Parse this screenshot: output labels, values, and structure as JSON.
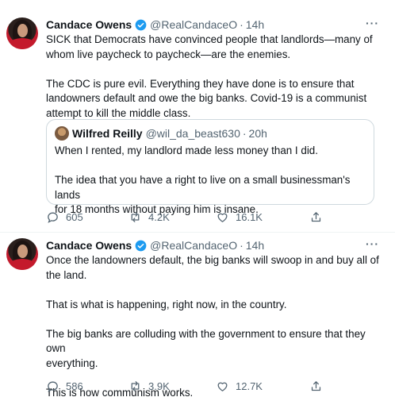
{
  "tweets": [
    {
      "author": {
        "name": "Candace Owens",
        "handle": "@RealCandaceO",
        "time": "14h"
      },
      "paragraphs": [
        [
          "SICK that Democrats have convinced people that landlords—many of",
          "whom live paycheck to paycheck—are the enemies."
        ],
        [
          "The CDC is pure evil. Everything they have done is to ensure that",
          "landowners default and owe the big banks. Covid-19 is a communist",
          "attempt to kill the middle class."
        ]
      ],
      "quote": {
        "author": {
          "name": "Wilfred Reilly",
          "handle": "@wil_da_beast630",
          "time": "20h"
        },
        "paragraphs": [
          [
            "When I rented, my landlord made less money than I did."
          ],
          [
            "The idea that you have a right to live on a small businessman's lands",
            "for 18 months without paying him is insane."
          ]
        ]
      },
      "stats": {
        "replies": "605",
        "retweets": "4.2K",
        "likes": "16.1K"
      }
    },
    {
      "author": {
        "name": "Candace Owens",
        "handle": "@RealCandaceO",
        "time": "14h"
      },
      "paragraphs": [
        [
          "Once the landowners default, the big banks will swoop in and buy all of",
          "the land."
        ],
        [
          "That is what is happening, right now, in the country."
        ],
        [
          "The big banks are colluding with the government to ensure that they own",
          "everything."
        ],
        [
          "This is how communism works."
        ]
      ],
      "stats": {
        "replies": "586",
        "retweets": "3.9K",
        "likes": "12.7K"
      }
    }
  ],
  "icons": {
    "verified": "verified-badge-icon",
    "more": "more-options-icon",
    "reply": "reply-icon",
    "retweet": "retweet-icon",
    "like": "like-icon",
    "share": "share-icon"
  },
  "colors": {
    "verified": "#1d9bf0",
    "secondary_text": "#536471",
    "primary_text": "#0f1419"
  }
}
